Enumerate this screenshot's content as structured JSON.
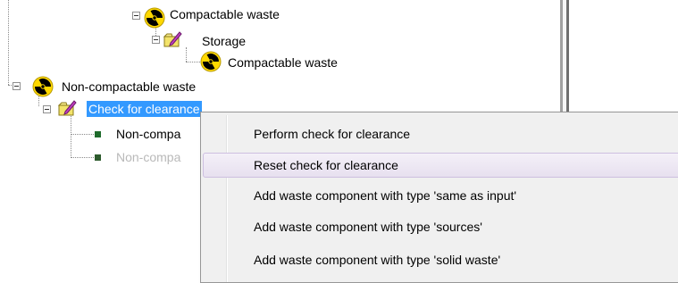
{
  "tree": {
    "nodes": [
      {
        "key": "compactable_waste_top",
        "label": "Compactable waste",
        "icon": "radiation-icon"
      },
      {
        "key": "storage",
        "label": "Storage",
        "icon": "folder-edit-icon"
      },
      {
        "key": "compactable_waste_child",
        "label": "Compactable waste",
        "icon": "radiation-icon"
      },
      {
        "key": "non_compactable_waste",
        "label": "Non-compactable waste",
        "icon": "radiation-icon"
      },
      {
        "key": "check_for_clearance",
        "label": "Check for clearance",
        "icon": "folder-edit-icon",
        "selected": true
      },
      {
        "key": "non_compa_1",
        "label": "Non-compa",
        "icon": "green-square-icon"
      },
      {
        "key": "non_compa_2",
        "label": "Non-compa",
        "icon": "green-square-icon",
        "disabled": true
      }
    ]
  },
  "context_menu": {
    "items": [
      {
        "label": "Perform check for clearance"
      },
      {
        "label": "Reset check for clearance",
        "highlighted": true
      },
      {
        "label": "Add waste component with type 'same as input'"
      },
      {
        "label": "Add waste component with type 'sources'"
      },
      {
        "label": "Add waste component with type 'solid waste'"
      }
    ]
  },
  "colors": {
    "selection": "#3399ff",
    "menu_background": "#f0f0f0",
    "menu_hover": "#e7e0ef",
    "radiation_yellow": "#ffd800",
    "green_square": "#1f6b2c"
  }
}
